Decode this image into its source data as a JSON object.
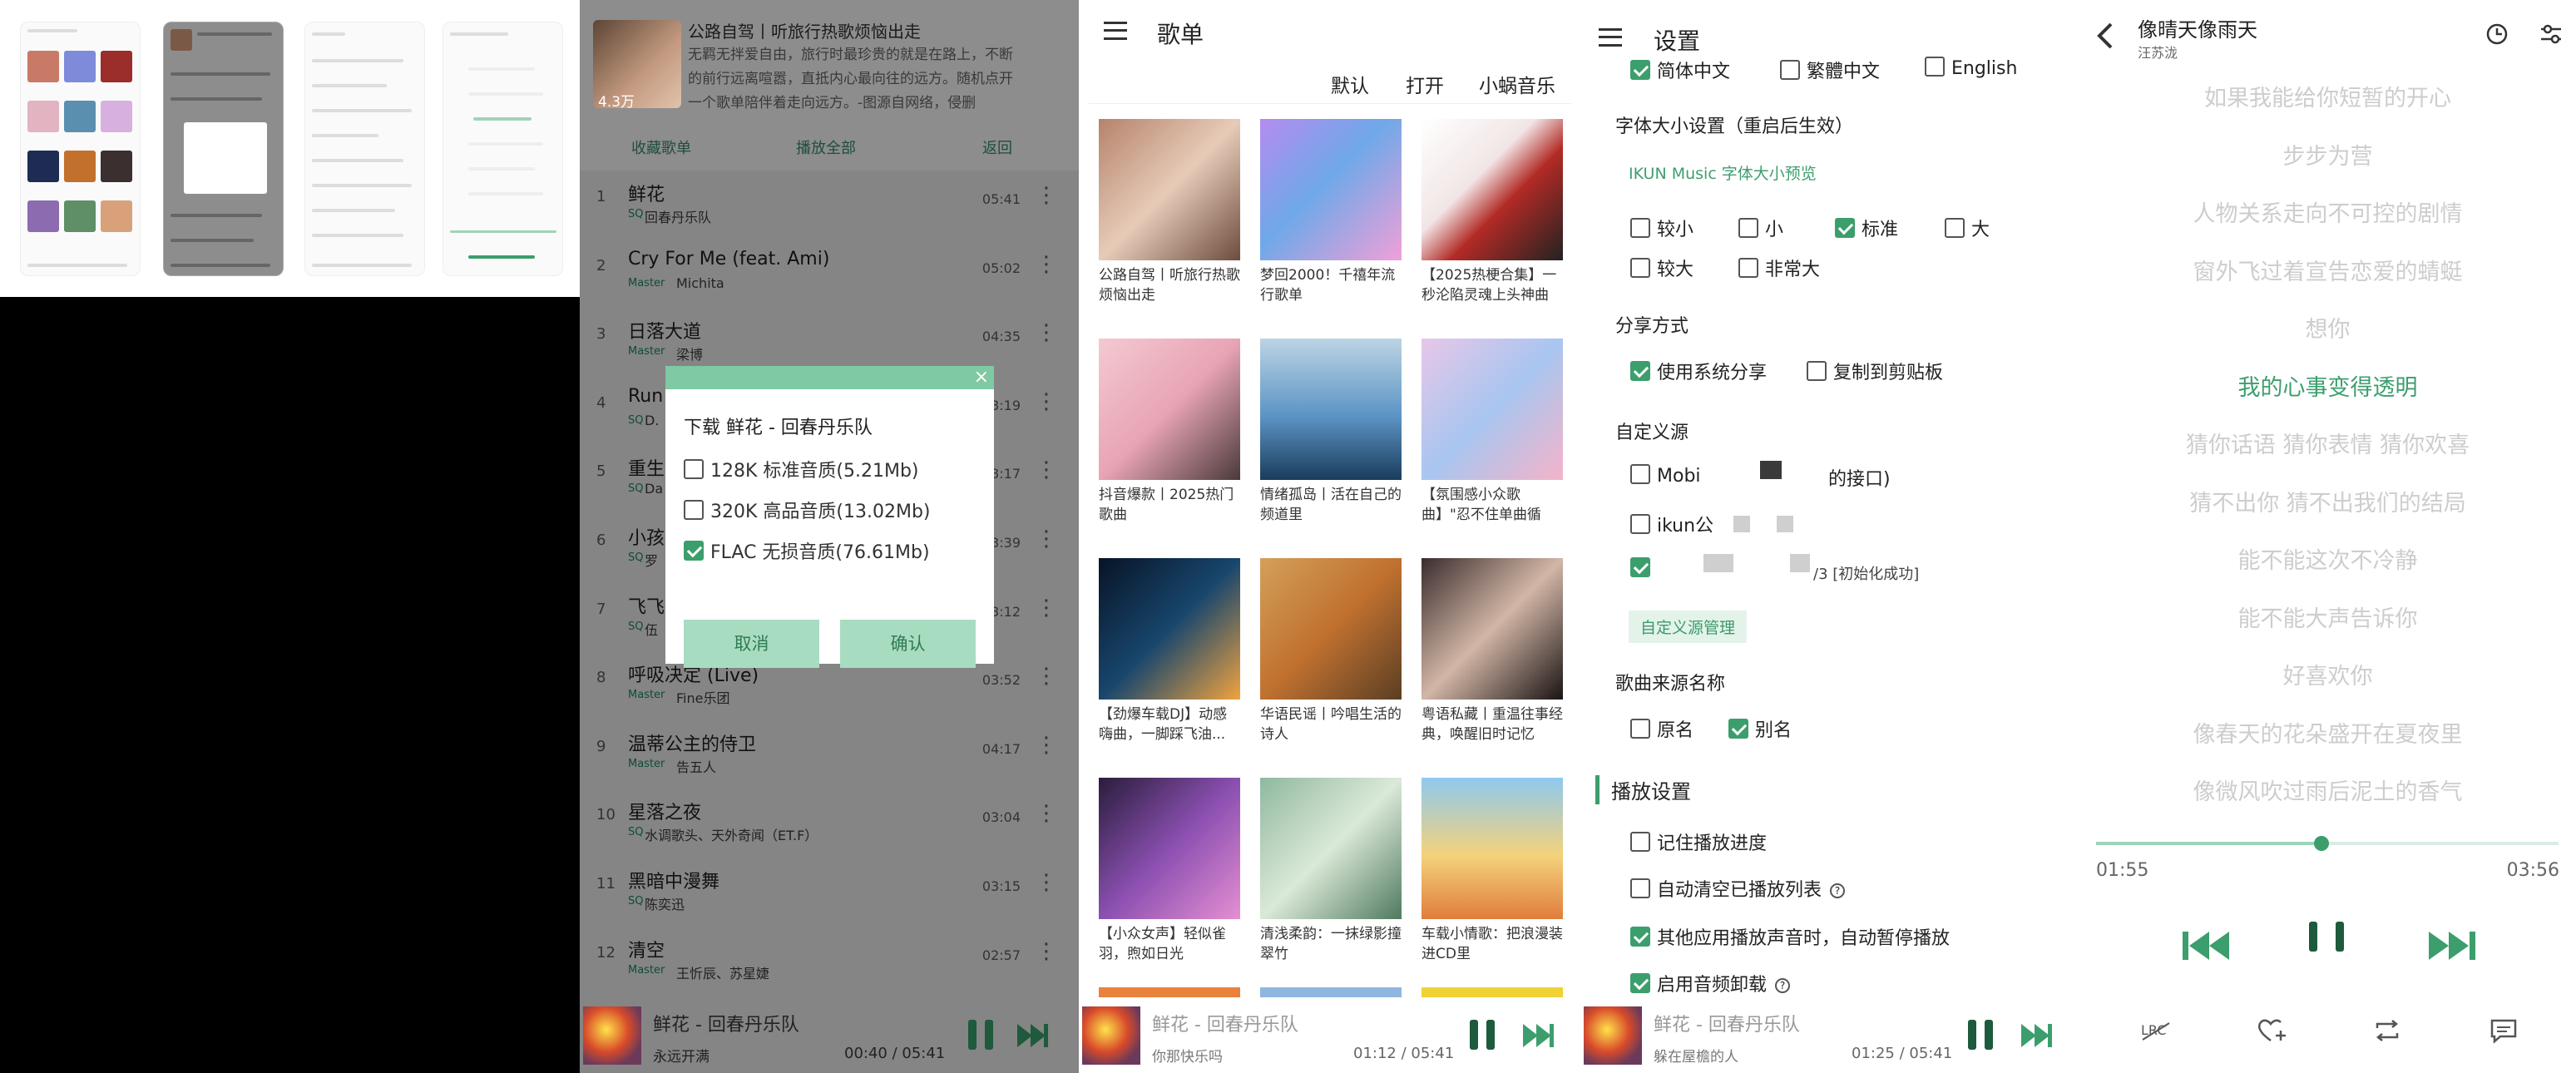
{
  "colors": {
    "accent": "#3c9e6d",
    "dialog_header": "#7fc9a4",
    "dim": "#858585"
  },
  "collage": {
    "alt": "app screenshot collage thumbnails"
  },
  "playlist_detail": {
    "title": "公路自驾丨听旅行热歌烦恼出走",
    "count": "4.3万",
    "desc_lines": [
      "无羁无拌爱自由，旅行时最珍贵的就是在路上，不断",
      "的前行远离喧嚣，直抵内心最向往的远方。随机点开",
      "一个歌单陪伴着走向远方。-图源自网络，侵删"
    ],
    "actions": {
      "collect": "收藏歌单",
      "play_all": "播放全部",
      "back": "返回"
    },
    "songs": [
      {
        "no": "1",
        "title": "鲜花",
        "quality": "SQ",
        "singer": "回春丹乐队",
        "duration": "05:41"
      },
      {
        "no": "2",
        "title": "Cry For Me (feat. Ami)",
        "quality": "Master",
        "singer": "Michita",
        "duration": "05:02"
      },
      {
        "no": "3",
        "title": "日落大道",
        "quality": "Master",
        "singer": "梁博",
        "duration": "04:35"
      },
      {
        "no": "4",
        "title": "Run",
        "quality": "SQ",
        "singer": "D.",
        "duration": "03:19"
      },
      {
        "no": "5",
        "title": "重生",
        "quality": "SQ",
        "singer": "Da",
        "duration": "03:17"
      },
      {
        "no": "6",
        "title": "小孩",
        "quality": "SQ",
        "singer": "罗",
        "duration": "03:39"
      },
      {
        "no": "7",
        "title": "飞飞",
        "quality": "SQ",
        "singer": "伍",
        "duration": "03:12"
      },
      {
        "no": "8",
        "title": "呼吸决定 (Live)",
        "quality": "Master",
        "singer": "Fine乐团",
        "duration": "03:52"
      },
      {
        "no": "9",
        "title": "温蒂公主的侍卫",
        "quality": "Master",
        "singer": "告五人",
        "duration": "04:17"
      },
      {
        "no": "10",
        "title": "星落之夜",
        "quality": "SQ",
        "singer": "水调歌头、天外奇闻（ET.F）",
        "duration": "03:04"
      },
      {
        "no": "11",
        "title": "黑暗中漫舞",
        "quality": "SQ",
        "singer": "陈奕迅",
        "duration": "03:15"
      },
      {
        "no": "12",
        "title": "清空",
        "quality": "Master",
        "singer": "王忻辰、苏星婕",
        "duration": "02:57"
      }
    ],
    "dialog": {
      "title": "下载 鲜花 - 回春丹乐队",
      "close": "×",
      "options": [
        "128K 标准音质(5.21Mb)",
        "320K 高品音质(13.02Mb)",
        "FLAC 无损音质(76.61Mb)"
      ],
      "selected": 2,
      "cancel": "取消",
      "confirm": "确认"
    },
    "player": {
      "title": "鲜花 - 回春丹乐队",
      "lyric": "永远开满",
      "time": "00:40 / 05:41"
    }
  },
  "songlists": {
    "title": "歌单",
    "filters": [
      "默认",
      "打开",
      "小蜗音乐"
    ],
    "cards": [
      {
        "caption": "公路自驾丨听旅行热歌烦恼出走"
      },
      {
        "caption": "梦回2000！千禧年流行歌单"
      },
      {
        "caption": "【2025热梗合集】一秒沦陷灵魂上头神曲"
      },
      {
        "caption": "抖音爆款丨2025热门歌曲"
      },
      {
        "caption": "情绪孤岛丨活在自己的频道里"
      },
      {
        "caption": "【氛围感小众歌曲】\"忍不住单曲循环！\""
      },
      {
        "caption": "【劲爆车载DJ】动感嗨曲，一脚踩飞油..."
      },
      {
        "caption": "华语民谣丨吟唱生活的诗人"
      },
      {
        "caption": "粤语私藏丨重温往事经典，唤醒旧时记忆"
      },
      {
        "caption": "【小众女声】轻似雀羽，煦如日光"
      },
      {
        "caption": "清浅柔韵：一抹绿影撞翠竹"
      },
      {
        "caption": "车载小情歌：把浪漫装进CD里"
      }
    ],
    "player": {
      "title": "鲜花 - 回春丹乐队",
      "lyric": "你那快乐吗",
      "time": "01:12 / 05:41"
    }
  },
  "settings": {
    "title": "设置",
    "lang": [
      "简体中文",
      "繁體中文",
      "English"
    ],
    "font_size_label": "字体大小设置（重启后生效）",
    "font_preview": "IKUN Music 字体大小预览",
    "sizes": [
      "较小",
      "小",
      "标准",
      "大",
      "较大",
      "非常大"
    ],
    "share_label": "分享方式",
    "share_opts": [
      "使用系统分享",
      "复制到剪贴板"
    ],
    "source_label": "自定义源",
    "sources": [
      "Mobi",
      "的接口)",
      "ikun公",
      "/3 [初始化成功]"
    ],
    "source_manage": "自定义源管理",
    "name_label": "歌曲来源名称",
    "name_opts": [
      "原名",
      "别名"
    ],
    "play_section": "播放设置",
    "play_opts": [
      "记住播放进度",
      "自动清空已播放列表",
      "其他应用播放声音时，自动暂停播放",
      "启用音频卸载"
    ],
    "player": {
      "title": "鲜花 - 回春丹乐队",
      "lyric": "躲在屋檐的人",
      "time": "01:25 / 05:41"
    }
  },
  "now_playing": {
    "title": "像晴天像雨天",
    "artist": "汪苏泷",
    "lyrics": [
      "如果我能给你短暂的开心",
      "步步为营",
      "人物关系走向不可控的剧情",
      "窗外飞过着宣告恋爱的蜻蜓",
      "想你",
      "我的心事变得透明",
      "猜你话语 猜你表情 猜你欢喜",
      "猜不出你 猜不出我们的结局",
      "能不能这次不冷静",
      "能不能大声告诉你",
      "好喜欢你",
      "像春天的花朵盛开在夏夜里",
      "像微风吹过雨后泥土的香气"
    ],
    "current_index": 5,
    "elapsed": "01:55",
    "total": "03:56",
    "progress": 0.487,
    "bottom_icons": [
      "lrc-icon",
      "heart-plus-icon",
      "repeat-icon",
      "comment-icon"
    ]
  }
}
